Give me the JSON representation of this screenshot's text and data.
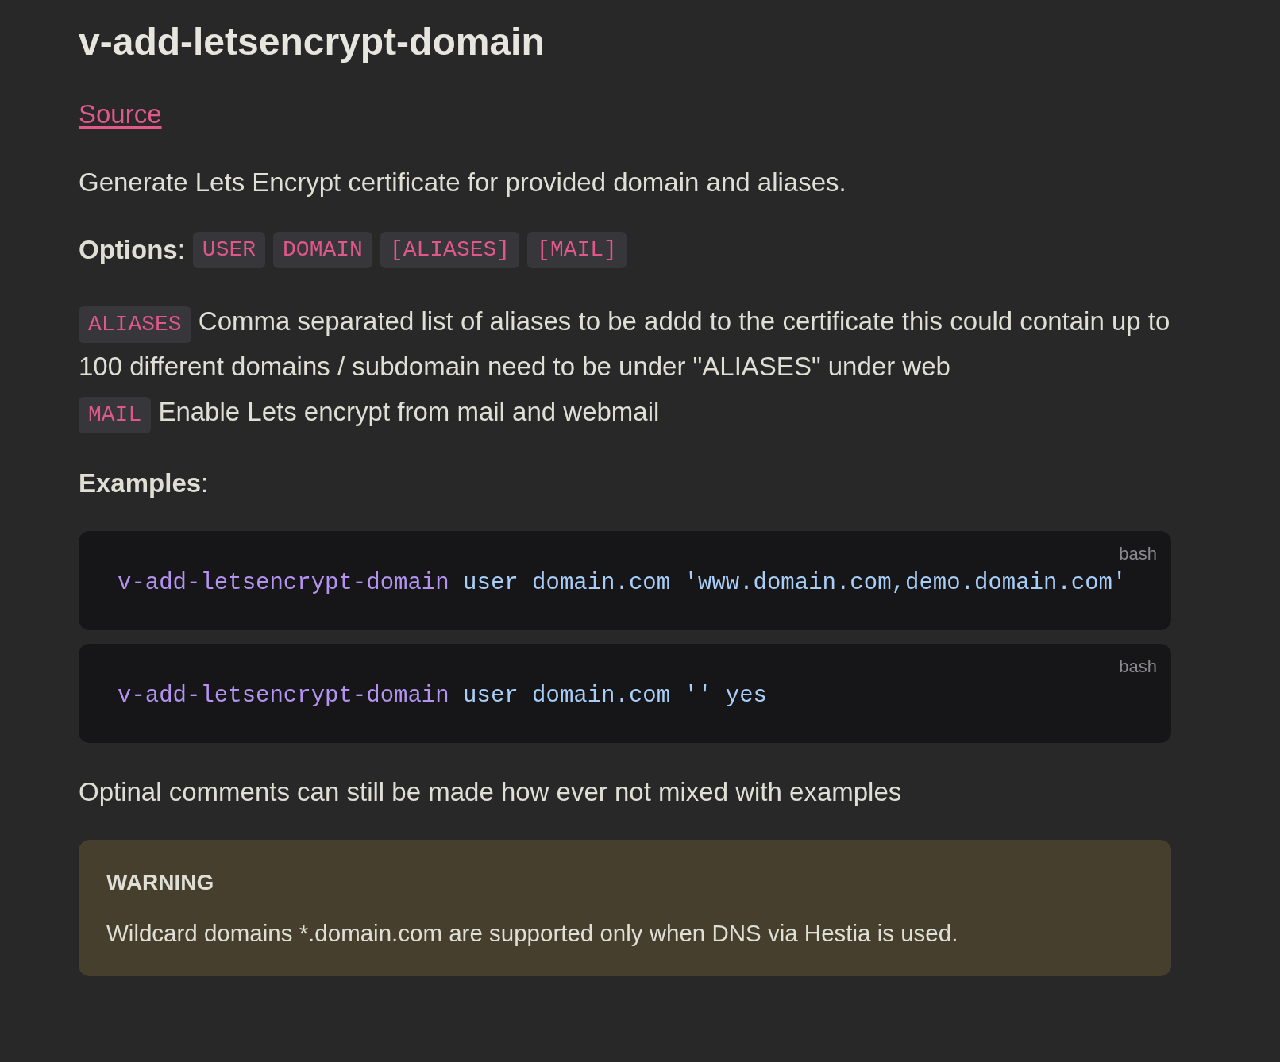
{
  "title": "v-add-letsencrypt-domain",
  "source_link": "Source",
  "description": "Generate Lets Encrypt certificate for provided domain and aliases.",
  "options": {
    "label": "**Options**:",
    "codes": [
      "USER",
      "DOMAIN",
      "[ALIASES]",
      "[MAIL]"
    ]
  },
  "option_descriptions": [
    {
      "code": "ALIASES",
      "text": "Comma separated list of aliases to be addd to the certificate this could contain up to 100 different domains / subdomain need to be under \"ALIASES\" under web"
    },
    {
      "code": "MAIL",
      "text": "Enable Lets encrypt from mail and webmail"
    }
  ],
  "examples_heading": "**Examples**:",
  "code_blocks": [
    {
      "lang": "bash",
      "tokens": [
        {
          "kind": "command",
          "text": "v-add-letsencrypt-domain"
        },
        {
          "kind": "arg",
          "text": "user"
        },
        {
          "kind": "arg",
          "text": "domain.com"
        },
        {
          "kind": "arg",
          "text": "'www.domain.com,demo.domain.com'"
        }
      ]
    },
    {
      "lang": "bash",
      "tokens": [
        {
          "kind": "command",
          "text": "v-add-letsencrypt-domain"
        },
        {
          "kind": "arg",
          "text": "user"
        },
        {
          "kind": "arg",
          "text": "domain.com"
        },
        {
          "kind": "arg",
          "text": "''"
        },
        {
          "kind": "arg",
          "text": "yes"
        }
      ]
    }
  ],
  "comment": "Optinal comments can still be made how ever not mixed with examples",
  "warning": {
    "title": "WARNING",
    "text": "Wildcard domains *.domain.com are supported only when DNS via Hestia is used."
  }
}
